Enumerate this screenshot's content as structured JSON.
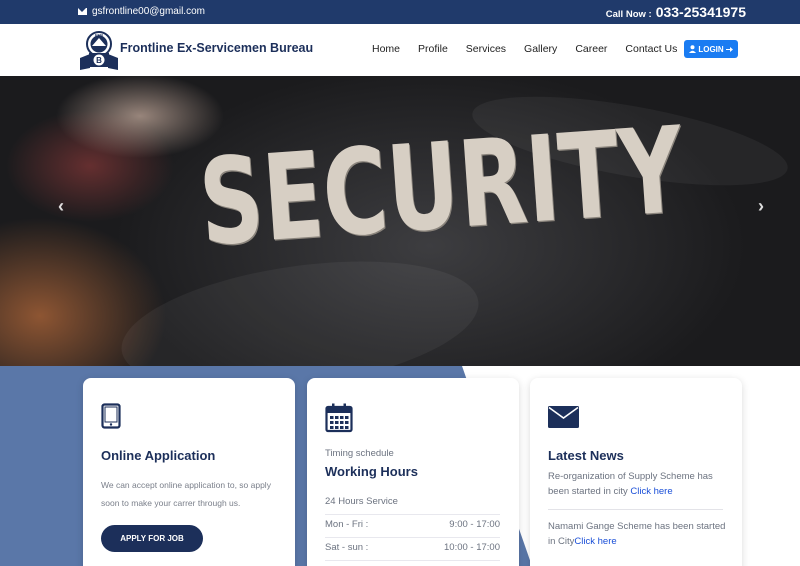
{
  "topbar": {
    "email": "gsfrontline00@gmail.com",
    "call_label": "Call Now :",
    "phone": "033-25341975",
    "mail_icon": "envelope-icon"
  },
  "nav": {
    "brand": "Frontline Ex-Servicemen Bureau",
    "logo_text": "FEB",
    "logo_letter": "B",
    "items": [
      {
        "label": "Home"
      },
      {
        "label": "Profile"
      },
      {
        "label": "Services"
      },
      {
        "label": "Gallery"
      },
      {
        "label": "Career"
      },
      {
        "label": "Contact Us"
      }
    ],
    "login_label": "LOGIN",
    "login_color": "#1a7cf2"
  },
  "hero": {
    "text": "SECURITY",
    "prev": "‹",
    "next": "›"
  },
  "cards": {
    "application": {
      "title": "Online Application",
      "body": "We can accept online application to, so apply soon to make your carrer through us.",
      "button": "APPLY FOR JOB",
      "icon": "tablet-icon"
    },
    "timing": {
      "subtitle": "Timing schedule",
      "title": "Working Hours",
      "service": "24 Hours Service",
      "rows": [
        {
          "day": "Mon - Fri :",
          "time": "9:00 - 17:00"
        },
        {
          "day": "Sat - sun :",
          "time": "10:00 - 17:00"
        }
      ],
      "icon": "calendar-icon"
    },
    "news": {
      "title": "Latest News",
      "items": [
        {
          "text": "Re-organization of Supply Scheme has been started in city ",
          "link": "Click here"
        },
        {
          "text": "Namami Gange Scheme has been started in City",
          "link": "Click here"
        }
      ],
      "icon": "envelope-icon"
    }
  },
  "colors": {
    "navy": "#1c2f5a",
    "topbar": "#203a6b",
    "band": "#5a77a8"
  }
}
